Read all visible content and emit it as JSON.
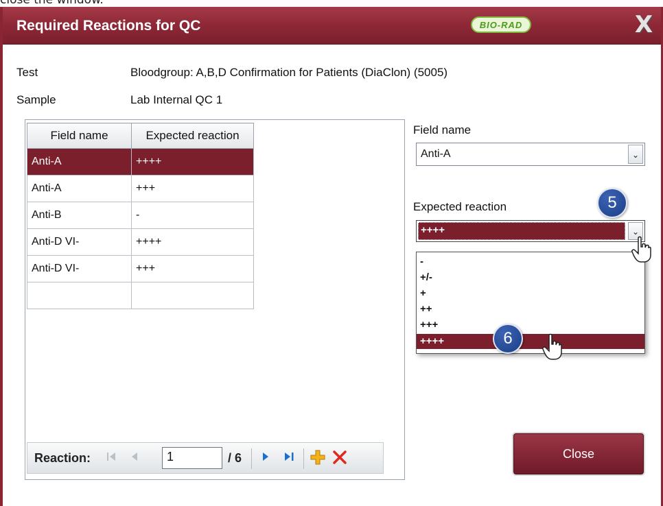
{
  "caption": "close the window.",
  "window": {
    "title": "Required Reactions for QC",
    "brand_logo": "BIO-RAD",
    "close_glyph": "X",
    "accent_color": "#8a2634"
  },
  "info": {
    "test_label": "Test",
    "test_value": "Bloodgroup: A,B,D Confirmation for Patients (DiaClon) (5005)",
    "sample_label": "Sample",
    "sample_value": "Lab Internal QC 1"
  },
  "grid": {
    "headers": [
      "Field name",
      "Expected reaction"
    ],
    "rows": [
      {
        "field": "Anti-A",
        "reaction": "++++",
        "selected": true
      },
      {
        "field": "Anti-A",
        "reaction": "+++"
      },
      {
        "field": "Anti-B",
        "reaction": "-"
      },
      {
        "field": "Anti-D VI-",
        "reaction": "++++"
      },
      {
        "field": "Anti-D VI-",
        "reaction": "+++"
      },
      {
        "field": "",
        "reaction": ""
      }
    ]
  },
  "navigator": {
    "label": "Reaction:",
    "current": "1",
    "total": "/ 6",
    "icons": [
      "first-icon",
      "prev-icon",
      "next-icon",
      "last-icon",
      "add-icon",
      "delete-icon"
    ]
  },
  "form": {
    "field_name_label": "Field name",
    "field_name_value": "Anti-A",
    "expected_reaction_label": "Expected reaction",
    "expected_reaction_value": "++++",
    "options": [
      "-",
      "+/-",
      "+",
      "++",
      "+++",
      "++++"
    ],
    "selected_option": "++++"
  },
  "steps": {
    "step5": "5",
    "step6": "6"
  },
  "buttons": {
    "close": "Close"
  }
}
